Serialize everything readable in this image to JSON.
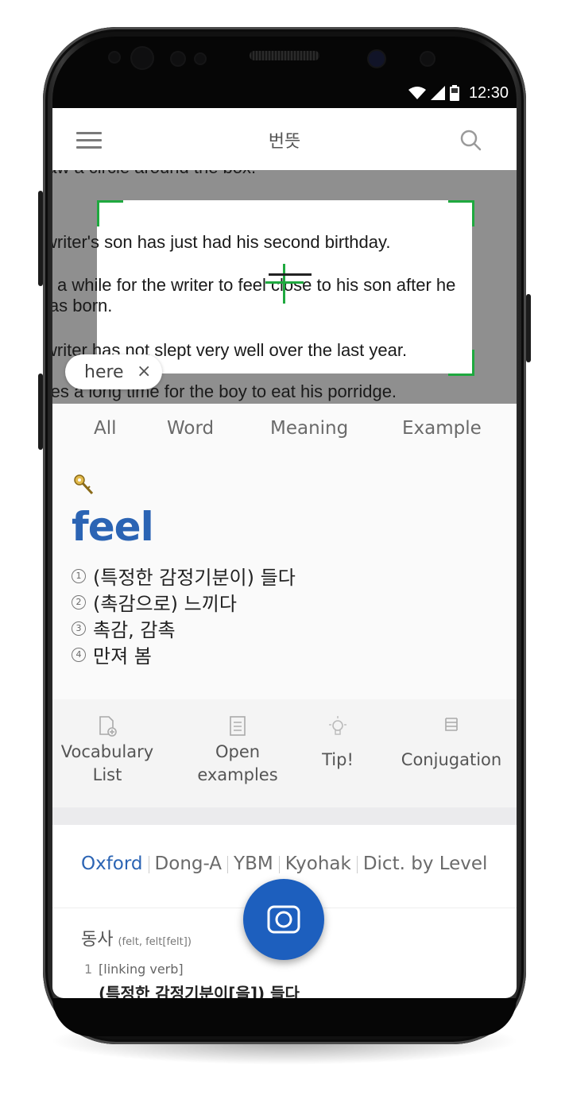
{
  "status_bar": {
    "time": "12:30"
  },
  "app_bar": {
    "title": "번뜻"
  },
  "camera_view": {
    "lines": [
      "Draw a circle around the box.",
      "The writer's son has just had his second birthday.",
      "It took a while for the writer to feel close to his son after he",
      "was born.",
      "The writer has not slept very well over the last year.",
      "It takes a long time for the boy to eat his porridge."
    ],
    "chip_label": "here",
    "chip_close": "×"
  },
  "tabs": [
    {
      "label": "All"
    },
    {
      "label": "Word"
    },
    {
      "label": "Meaning"
    },
    {
      "label": "Example"
    }
  ],
  "word_card": {
    "headword": "feel",
    "meanings": [
      {
        "num": "1",
        "text": "(특정한 감정기분이) 들다"
      },
      {
        "num": "2",
        "text": "(촉감으로) 느끼다"
      },
      {
        "num": "3",
        "text": "촉감, 감촉"
      },
      {
        "num": "4",
        "text": "만져 봄"
      }
    ]
  },
  "actions": [
    {
      "line1": "Vocabulary",
      "line2": "List",
      "icon": "add-document-icon"
    },
    {
      "line1": "Open",
      "line2": "examples",
      "icon": "notepad-icon"
    },
    {
      "line1": "Tip!",
      "line2": "",
      "icon": "lightbulb-icon"
    },
    {
      "line1": "Conjugation",
      "line2": "",
      "icon": "stack-icon"
    }
  ],
  "dictionaries": [
    "Oxford",
    "Dong-A",
    "YBM",
    "Kyohak",
    "Dict. by Level"
  ],
  "entry": {
    "pos": "동사",
    "forms": "(felt, felt[felt])",
    "sense_number": "1",
    "sense_type": "[linking verb]",
    "definition": "(특정한 감정기분이[을]) 들다"
  },
  "colors": {
    "accent": "#2b64b4",
    "fab": "#1d5fbe",
    "scan_frame": "#1fa93f"
  }
}
